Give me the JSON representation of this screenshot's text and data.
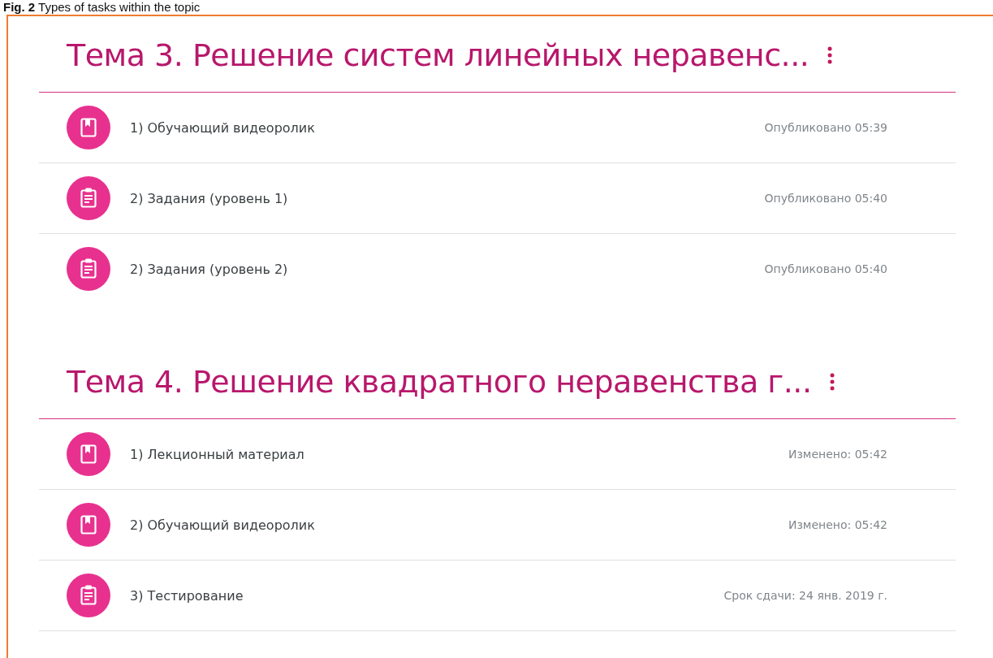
{
  "caption": "**Fig. 2** Types of tasks within the topic",
  "topics": [
    {
      "title": "Тема 3. Решение систем линейных неравенс...",
      "items": [
        {
          "kind": "material",
          "title": "1) Обучающий видеоролик",
          "meta": "Опубликовано 05:39"
        },
        {
          "kind": "assignment",
          "title": "2) Задания (уровень 1)",
          "meta": "Опубликовано 05:40"
        },
        {
          "kind": "assignment",
          "title": "2) Задания (уровень 2)",
          "meta": "Опубликовано 05:40"
        }
      ]
    },
    {
      "title": "Тема 4. Решение квадратного неравенства г...",
      "items": [
        {
          "kind": "material",
          "title": "1) Лекционный материал",
          "meta": "Изменено: 05:42"
        },
        {
          "kind": "material",
          "title": "2) Обучающий видеоролик",
          "meta": "Изменено: 05:42"
        },
        {
          "kind": "assignment",
          "title": "3) Тестирование",
          "meta": "Срок сдачи: 24 янв. 2019 г."
        }
      ]
    }
  ]
}
